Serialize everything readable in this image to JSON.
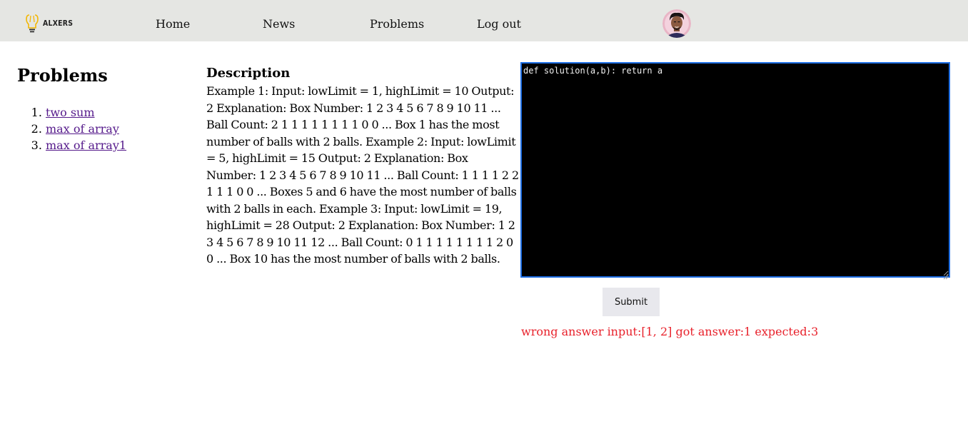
{
  "header": {
    "logo_text": "ALXERS",
    "nav": [
      {
        "label": "Home"
      },
      {
        "label": "News"
      },
      {
        "label": "Problems"
      },
      {
        "label": "Log out"
      }
    ],
    "avatar_icon": "user-avatar"
  },
  "sidebar": {
    "title": "Problems",
    "problems": [
      {
        "label": "two sum"
      },
      {
        "label": "max of array"
      },
      {
        "label": "max of array1"
      }
    ]
  },
  "description": {
    "title": "Description",
    "text": "Example 1: Input: lowLimit = 1, highLimit = 10 Output: 2 Explanation: Box Number: 1 2 3 4 5 6 7 8 9 10 11 ... Ball Count: 2 1 1 1 1 1 1 1 1 0 0 ... Box 1 has the most number of balls with 2 balls. Example 2: Input: lowLimit = 5, highLimit = 15 Output: 2 Explanation: Box Number: 1 2 3 4 5 6 7 8 9 10 11 ... Ball Count: 1 1 1 1 2 2 1 1 1 0 0 ... Boxes 5 and 6 have the most number of balls with 2 balls in each. Example 3: Input: lowLimit = 19, highLimit = 28 Output: 2 Explanation: Box Number: 1 2 3 4 5 6 7 8 9 10 11 12 ... Ball Count: 0 1 1 1 1 1 1 1 1 2 0 0 ... Box 10 has the most number of balls with 2 balls."
  },
  "editor": {
    "code": "def solution(a,b): return a"
  },
  "submit": {
    "label": "Submit"
  },
  "result": {
    "message": "wrong answer input:[1, 2] got answer:1 expected:3",
    "color": "#e8212b"
  },
  "colors": {
    "header_bg": "#e5e6e3",
    "link_visited": "#551a8b",
    "editor_border": "#1f6fe5",
    "logo_accent": "#f2b705"
  }
}
